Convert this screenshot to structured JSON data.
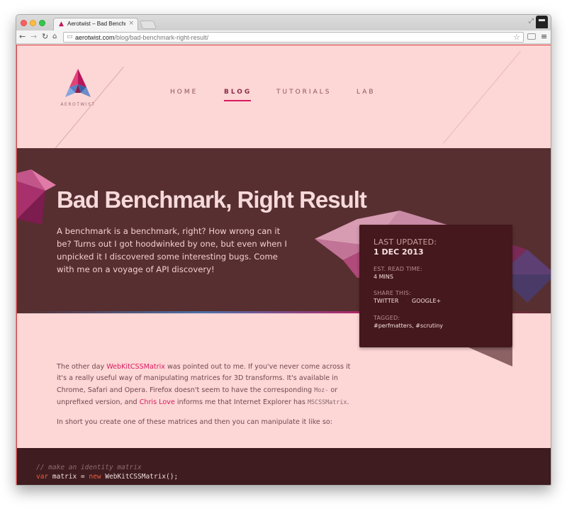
{
  "browser": {
    "tab_title": "Aerotwist – Bad Benchmark",
    "tab_close": "×",
    "url_host": "aerotwist.com",
    "url_path": "/blog/bad-benchmark-right-result/",
    "icons": [
      "back-icon",
      "forward-icon",
      "reload-icon",
      "home-icon",
      "page-icon",
      "star-icon",
      "extension-icon",
      "menu-icon",
      "fullscreen-icon",
      "profile-icon"
    ]
  },
  "site": {
    "logo_text": "AEROTWIST",
    "nav": {
      "home": "HOME",
      "blog": "BLOG",
      "tutorials": "TUTORIALS",
      "lab": "LAB"
    }
  },
  "hero": {
    "title": "Bad Benchmark, Right Result",
    "summary": "A benchmark is a benchmark, right? How wrong can it be? Turns out I got hoodwinked by one, but even when I unpicked it I discovered some interesting bugs. Come with me on a voyage of API discovery!"
  },
  "meta": {
    "updated_label": "LAST UPDATED:",
    "updated_value": "1 DEC 2013",
    "read_label": "EST. READ TIME:",
    "read_value": "4 MINS",
    "share_label": "SHARE THIS:",
    "share_twitter": "TWITTER",
    "share_sep": "·",
    "share_google": "GOOGLE+",
    "tagged_label": "TAGGED:",
    "tagged_value": "#perfmatters, #scrutiny"
  },
  "article": {
    "p1_a": "The other day ",
    "p1_link1": "WebKitCSSMatrix",
    "p1_b": " was pointed out to me. If you've never come across it it's a really useful way of manipulating matrices for 3D transforms. It's available in Chrome, Safari and Opera. Firefox doesn't seem to have the corresponding ",
    "p1_code1": "Moz-",
    "p1_c": " or unprefixed version, and ",
    "p1_link2": "Chris Love",
    "p1_d": " informs me that Internet Explorer has ",
    "p1_code2": "MSCSSMatrix",
    "p1_e": ".",
    "p2": "In short you create one of these matrices and then you can manipulate it like so:"
  },
  "code": {
    "line1": "// make an identity matrix",
    "line2_kw1": "var",
    "line2_a": " matrix = ",
    "line2_kw2": "new",
    "line2_b": " WebKitCSSMatrix();"
  },
  "colors": {
    "accent": "#d81b60",
    "hero_bg": "#572f30",
    "page_bg": "#fdd6d6",
    "card_bg": "#44181c"
  }
}
